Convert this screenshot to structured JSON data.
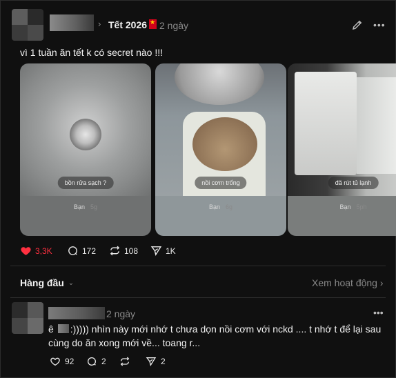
{
  "post": {
    "topic": "Tết 2026",
    "time": "2 ngày",
    "text": "vì 1 tuần ăn tết k có secret nào !!!",
    "icons": {
      "edit": "edit-icon",
      "more": "more-icon"
    },
    "cards": [
      {
        "label": "bồn rửa sạch ?",
        "reply_name": "Bạn",
        "reply_time": "5g"
      },
      {
        "label": "nồi cơm trống",
        "reply_name": "Bạn",
        "reply_time": "6g"
      },
      {
        "label": "đã rút tủ lạnh",
        "reply_name": "Bạn",
        "reply_time": "5ph"
      }
    ],
    "actions": {
      "likes": "3,3K",
      "comments": "172",
      "reposts": "108",
      "shares": "1K"
    },
    "like_color": "#ff3040"
  },
  "sort": {
    "label": "Hàng đầu",
    "view_activity": "Xem hoạt động"
  },
  "reply": {
    "time": "2 ngày",
    "text_prefix": "ê",
    "text_body": ":))))) nhìn này mới nhớ t chưa dọn nồi cơm với nckd .... t nhớ t để lại sau cùng do ăn xong mới về... toang r...",
    "actions": {
      "likes": "92",
      "comments": "2",
      "shares": "2"
    }
  }
}
